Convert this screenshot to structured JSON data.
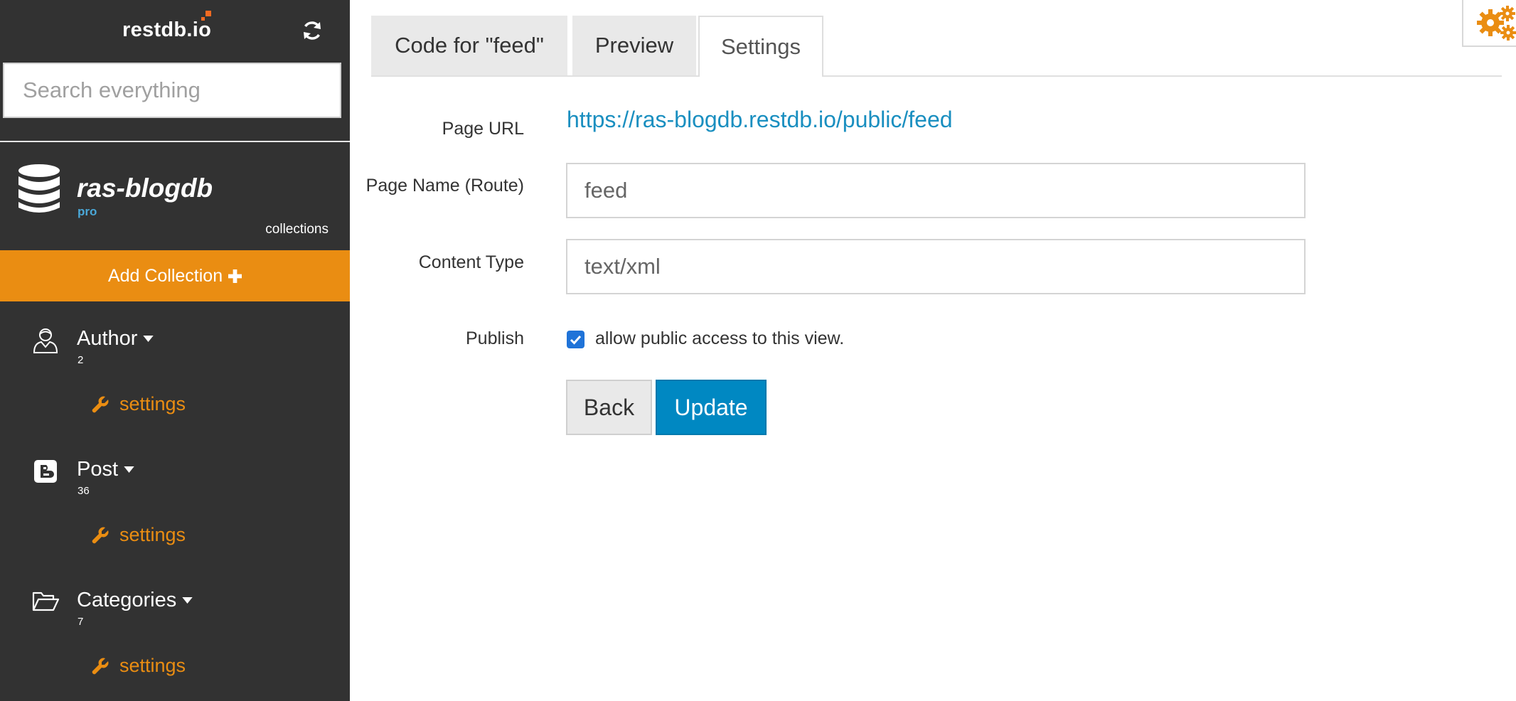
{
  "sidebar": {
    "logo": "restdb.io",
    "search_placeholder": "Search everything",
    "db_name": "ras-blogdb",
    "db_plan": "pro",
    "collections_label": "collections",
    "add_collection_label": "Add Collection",
    "collections": [
      {
        "name": "Author",
        "count": "2",
        "settings_label": "settings",
        "icon": "user-icon"
      },
      {
        "name": "Post",
        "count": "36",
        "settings_label": "settings",
        "icon": "blogger-icon"
      },
      {
        "name": "Categories",
        "count": "7",
        "settings_label": "settings",
        "icon": "folder-open-icon"
      }
    ]
  },
  "tabs": [
    {
      "label": "Code for \"feed\"",
      "active": false
    },
    {
      "label": "Preview",
      "active": false
    },
    {
      "label": "Settings",
      "active": true
    }
  ],
  "form": {
    "page_url_label": "Page URL",
    "page_url": "https://ras-blogdb.restdb.io/public/feed",
    "page_name_label": "Page Name (Route)",
    "page_name_value": "feed",
    "content_type_label": "Content Type",
    "content_type_value": "text/xml",
    "publish_label": "Publish",
    "publish_checked": true,
    "publish_text": "allow public access to this view.",
    "back_label": "Back",
    "update_label": "Update"
  },
  "colors": {
    "sidebar_bg": "#323232",
    "accent_orange": "#ea8d12",
    "link_blue": "#1a8fc0",
    "primary_button": "#0088c2"
  }
}
